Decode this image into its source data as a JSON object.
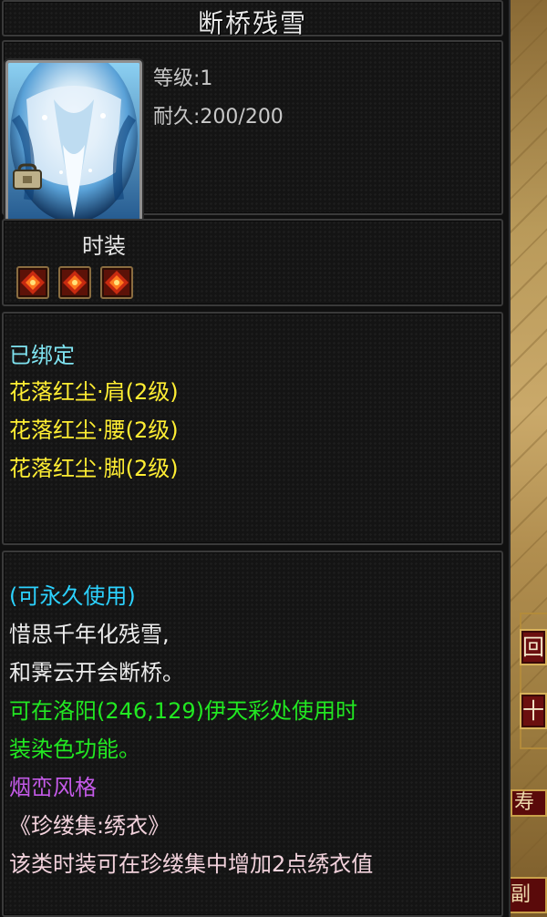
{
  "item": {
    "title": "断桥残雪",
    "level": "等级:1",
    "durability": "耐久:200/200",
    "type": "时装",
    "bound": "已绑定",
    "set_pieces": [
      "花落红尘·肩(2级)",
      "花落红尘·腰(2级)",
      "花落红尘·脚(2级)"
    ],
    "usage": "(可永久使用)",
    "poem": [
      "惜思千年化残雪,",
      "和霁云开会断桥。"
    ],
    "dye_info": [
      "可在洛阳(246,129)伊天彩处使用时",
      "装染色功能。"
    ],
    "style": "烟峦风格",
    "collection": "《珍缕集:绣衣》",
    "collection_info": "该类时装可在珍缕集中增加2点绣衣值"
  },
  "side": {
    "button_1": "回",
    "button_2": "十",
    "tab_1": "寿",
    "tab_2": "副"
  },
  "colors": {
    "bound": "#7fe3f0",
    "set": "#ffee33",
    "usage": "#2cd2ff",
    "dye": "#22e822",
    "style": "#c45ae8",
    "collection": "#f2d2dc"
  },
  "icons": [
    "bind-lock-icon",
    "red-gem-icon"
  ]
}
